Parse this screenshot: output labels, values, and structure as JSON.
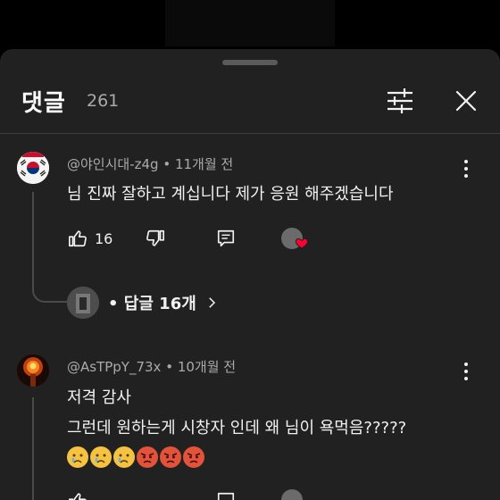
{
  "header": {
    "title": "댓글",
    "count": "261"
  },
  "comments": [
    {
      "author": "@야인시대-z4g",
      "time": "11개월 전",
      "lines": [
        "님 진짜 잘하고 계십니다 제가 응원 해주겠습니다"
      ],
      "likes": "16",
      "replies_label": "답글 16개",
      "avatar_icon": "korea-flag-icon"
    },
    {
      "author": "@AsTPpY_73x",
      "time": "10개월 전",
      "lines": [
        "저격 감사",
        "그런데 원하는게 시창자 인데 왜 님이 욕먹음?????"
      ],
      "emojis": [
        "crying-face",
        "crying-face",
        "crying-face",
        "angry-face",
        "angry-face",
        "angry-face"
      ],
      "avatar_icon": "explosion-icon"
    }
  ],
  "colors": {
    "background": "#212121",
    "heart": "#ff0033",
    "secondary_text": "#aaaaaa"
  }
}
